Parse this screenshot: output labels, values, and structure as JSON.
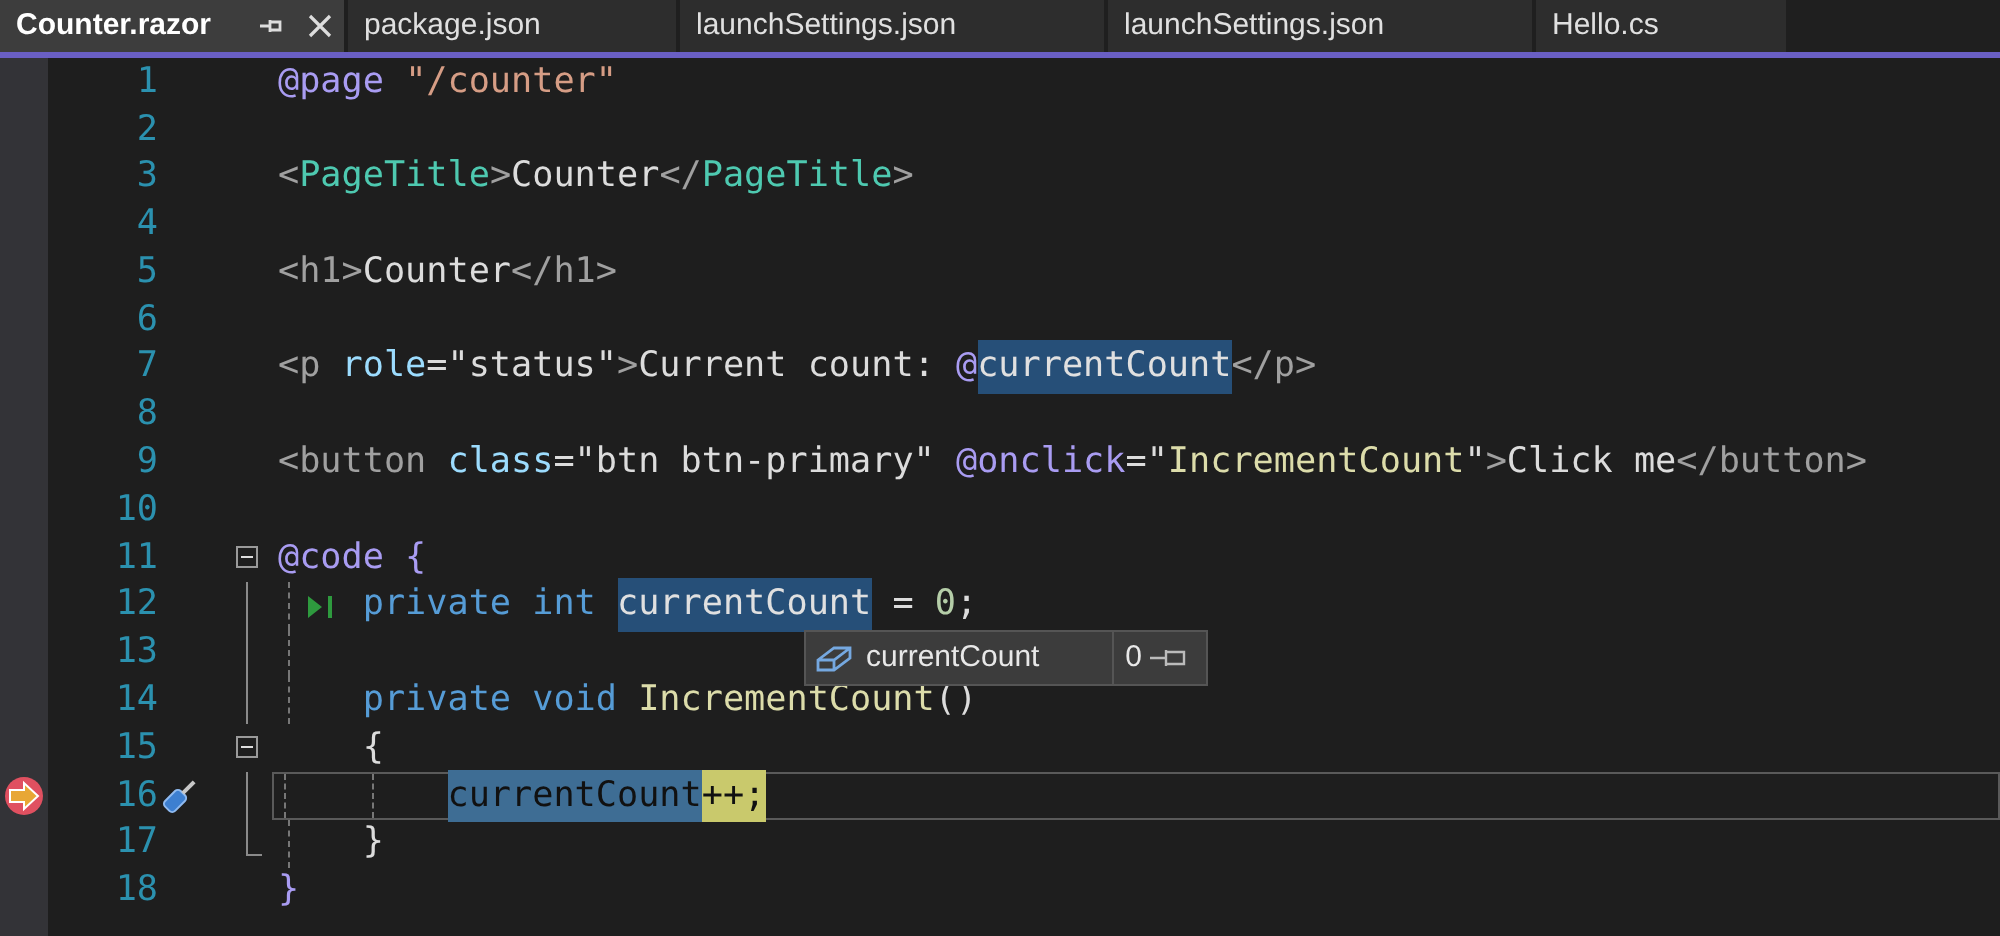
{
  "tabs": [
    {
      "label": "Counter.razor",
      "selected": true,
      "pinnable": true,
      "closable": true
    },
    {
      "label": "package.json",
      "selected": false
    },
    {
      "label": "launchSettings.json",
      "selected": false
    },
    {
      "label": "launchSettings.json",
      "selected": false
    },
    {
      "label": "Hello.cs",
      "selected": false
    }
  ],
  "editor": {
    "lines": [
      {
        "number": "1",
        "kind": "plain",
        "tokens": [
          {
            "text": "@page",
            "kind": "razor"
          },
          {
            "text": " \"/counter\"",
            "kind": "string"
          }
        ]
      },
      {
        "number": "2",
        "kind": "plain"
      },
      {
        "number": "3",
        "kind": "plain",
        "tokens": [
          {
            "text": "<",
            "kind": "punct"
          },
          {
            "text": "PageTitle",
            "kind": "component"
          },
          {
            "text": ">",
            "kind": "punct"
          },
          {
            "text": "Counter",
            "kind": "plain"
          },
          {
            "text": "</",
            "kind": "punct"
          },
          {
            "text": "PageTitle",
            "kind": "component"
          },
          {
            "text": ">",
            "kind": "punct"
          }
        ]
      },
      {
        "number": "4",
        "kind": "plain"
      },
      {
        "number": "5",
        "kind": "plain",
        "tokens": [
          {
            "text": "<h1>",
            "kind": "punct"
          },
          {
            "text": "Counter",
            "kind": "plain"
          },
          {
            "text": "</h1>",
            "kind": "punct"
          }
        ]
      },
      {
        "number": "6",
        "kind": "plain"
      },
      {
        "number": "7",
        "kind": "plain",
        "tokens": [
          {
            "text": "<p",
            "kind": "punct"
          },
          {
            "text": " role",
            "kind": "attribute"
          },
          {
            "text": "=\"status\"",
            "kind": "plain"
          },
          {
            "text": ">",
            "kind": "punct"
          },
          {
            "text": "Current count: ",
            "kind": "plain"
          },
          {
            "text": "@",
            "kind": "razor"
          },
          {
            "text": "currentCount",
            "kind": "reference"
          },
          {
            "text": "</p>",
            "kind": "punct"
          }
        ]
      },
      {
        "number": "8",
        "kind": "plain"
      },
      {
        "number": "9",
        "kind": "plain",
        "tokens": [
          {
            "text": "<button",
            "kind": "punct"
          },
          {
            "text": " class",
            "kind": "attribute"
          },
          {
            "text": "=\"btn btn-primary\"",
            "kind": "plain"
          },
          {
            "text": " @onclick",
            "kind": "razor"
          },
          {
            "text": "=\"",
            "kind": "plain"
          },
          {
            "text": "IncrementCount",
            "kind": "method"
          },
          {
            "text": "\"",
            "kind": "plain"
          },
          {
            "text": ">",
            "kind": "punct"
          },
          {
            "text": "Click me",
            "kind": "plain"
          },
          {
            "text": "</button>",
            "kind": "punct"
          }
        ]
      },
      {
        "number": "10",
        "kind": "plain"
      },
      {
        "number": "11",
        "kind": "fold-start",
        "expanded": true,
        "tokens": [
          {
            "text": "@code {",
            "kind": "razor"
          }
        ]
      },
      {
        "number": "12",
        "kind": "fold-inside",
        "run_to_click": true,
        "tokens": [
          {
            "text": "    private int",
            "kind": "keyword"
          },
          {
            "text": " currentCount",
            "kind": "reference"
          },
          {
            "text": " = ",
            "kind": "plain"
          },
          {
            "text": "0",
            "kind": "number"
          },
          {
            "text": ";",
            "kind": "plain"
          }
        ]
      },
      {
        "number": "13",
        "kind": "fold-inside"
      },
      {
        "number": "14",
        "kind": "fold-inside",
        "tokens": [
          {
            "text": "    private void",
            "kind": "keyword"
          },
          {
            "text": " IncrementCount",
            "kind": "method"
          },
          {
            "text": "()",
            "kind": "plain"
          }
        ]
      },
      {
        "number": "15",
        "kind": "fold-start",
        "expanded": true,
        "tokens": [
          {
            "text": "    {",
            "kind": "plain"
          }
        ]
      },
      {
        "number": "16",
        "kind": "fold-inside",
        "current": true,
        "quick_actions": true,
        "tokens": [
          {
            "text": "        currentCount",
            "kind": "current-reference"
          },
          {
            "text": "++;",
            "kind": "current-statement"
          }
        ]
      },
      {
        "number": "17",
        "kind": "fold-end",
        "tokens": [
          {
            "text": "    }",
            "kind": "plain"
          }
        ]
      },
      {
        "number": "18",
        "kind": "plain",
        "tokens": [
          {
            "text": "}",
            "kind": "razor"
          }
        ]
      }
    ],
    "datatip": {
      "name": "currentCount",
      "value": "0"
    }
  }
}
